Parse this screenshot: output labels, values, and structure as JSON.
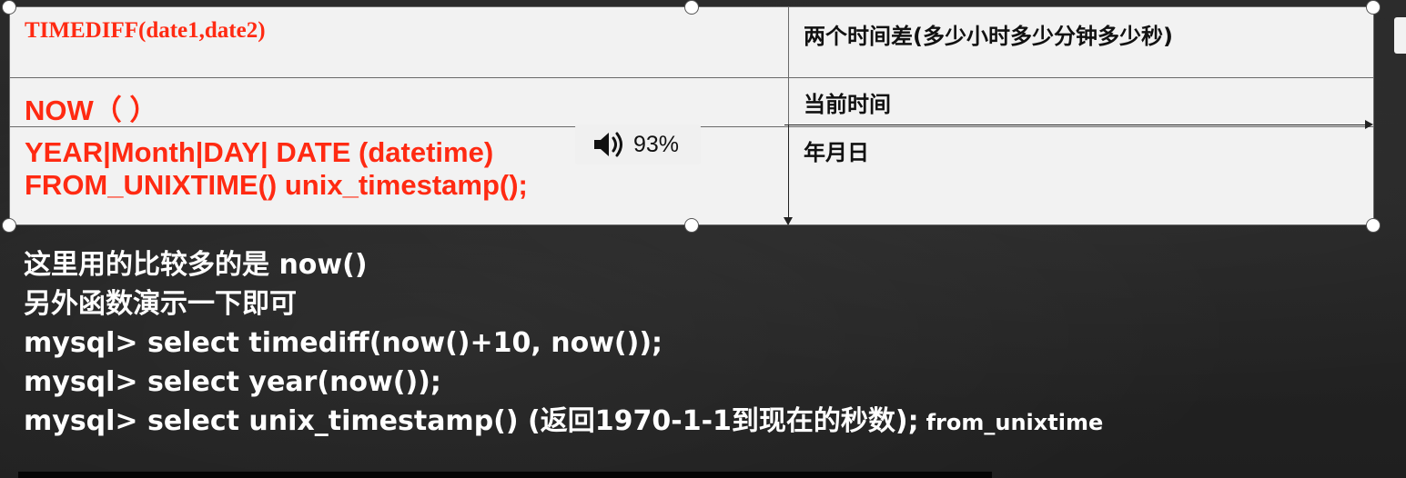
{
  "table": {
    "rows": [
      {
        "function": "TIMEDIFF(date1,date2)",
        "description": "两个时间差(多少小时多少分钟多少秒)"
      },
      {
        "function": "NOW（  ）",
        "description": "当前时间"
      },
      {
        "function_lines": [
          "YEAR|Month|DAY| DATE (datetime)",
          "FROM_UNIXTIME()  unix_timestamp();"
        ],
        "description": "年月日"
      }
    ]
  },
  "volume_osd": {
    "icon": "speaker-icon",
    "level": "93%"
  },
  "notes": {
    "lines": [
      "这里用的比较多的是 now()",
      "另外函数演示一下即可",
      "mysql> select timediff(now()+10, now());",
      "mysql> select year(now());",
      "mysql> select unix_timestamp() (返回1970-1-1到现在的秒数);"
    ],
    "last_line_suffix": "from_unixtime"
  },
  "colors": {
    "function_red": "#ff2a12",
    "table_bg": "#f2f2f2",
    "slide_bg": "#262626"
  }
}
